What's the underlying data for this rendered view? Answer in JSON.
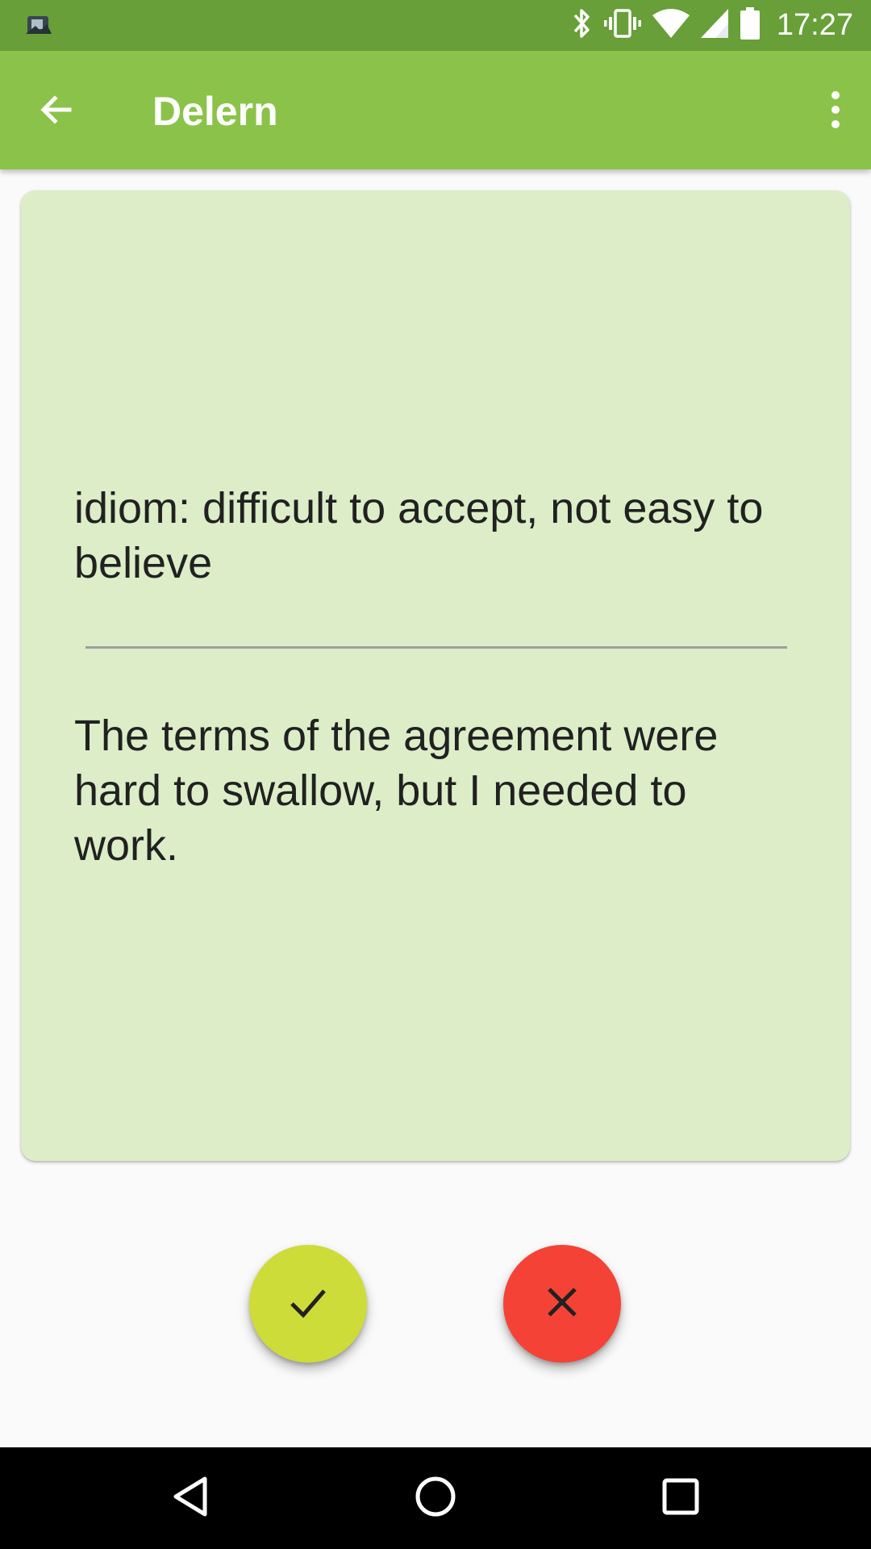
{
  "status_bar": {
    "time": "17:27",
    "icons": [
      "app-notification-icon",
      "bluetooth-icon",
      "vibrate-icon",
      "wifi-icon",
      "cell-signal-icon",
      "battery-icon"
    ]
  },
  "app_bar": {
    "title": "Delern",
    "back_icon": "arrow-back-icon",
    "menu_icon": "more-vert-icon"
  },
  "card": {
    "front_text": "idiom: difficult to accept, not easy to believe",
    "back_text": "The terms of the agreement were hard to swallow, but I needed to work.",
    "background_color": "#dcedc8"
  },
  "actions": {
    "correct_icon": "check-icon",
    "correct_color": "#cddc39",
    "wrong_icon": "close-icon",
    "wrong_color": "#f44336"
  },
  "colors": {
    "primary": "#8bc34a",
    "primary_dark": "#689f38"
  },
  "nav_bar": {
    "icons": [
      "nav-back-icon",
      "nav-home-icon",
      "nav-recents-icon"
    ]
  }
}
